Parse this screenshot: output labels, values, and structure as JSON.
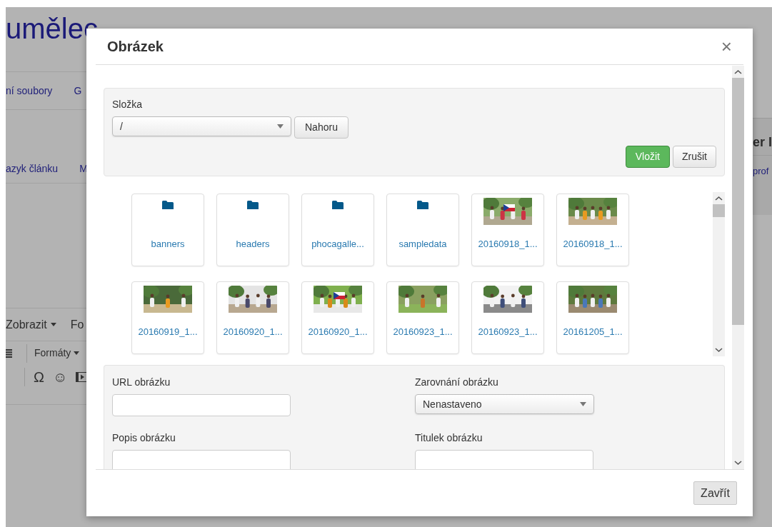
{
  "page": {
    "title": "umělec",
    "nav": [
      "ní soubory",
      "G"
    ],
    "subnav": [
      "azyk článku",
      "M"
    ],
    "editor_menu": [
      {
        "label": "Zobrazit",
        "caret": true
      },
      {
        "label": "Fo",
        "caret": false
      }
    ],
    "formats": "Formáty",
    "symbols": [
      "Ω",
      "☺"
    ],
    "side_heading": "er I",
    "side_link": "prof"
  },
  "dialog": {
    "title": "Obrázek",
    "close": "×",
    "folder_label": "Složka",
    "folder_value": "/",
    "up_button": "Nahoru",
    "insert_button": "Vložit",
    "cancel_button": "Zrušit",
    "items": [
      {
        "kind": "folder",
        "name": "banners"
      },
      {
        "kind": "folder",
        "name": "headers"
      },
      {
        "kind": "folder",
        "name": "phocagalle..."
      },
      {
        "kind": "folder",
        "name": "sampledata"
      },
      {
        "kind": "picture",
        "name": "20160918_1..."
      },
      {
        "kind": "picture",
        "name": "20160918_1..."
      },
      {
        "kind": "picture",
        "name": "20160919_1..."
      },
      {
        "kind": "picture",
        "name": "20160920_1..."
      },
      {
        "kind": "picture",
        "name": "20160920_1..."
      },
      {
        "kind": "picture",
        "name": "20160923_1..."
      },
      {
        "kind": "picture",
        "name": "20160923_1..."
      },
      {
        "kind": "picture",
        "name": "20161205_1..."
      }
    ],
    "fields": [
      {
        "kind": "text",
        "label": "URL obrázku"
      },
      {
        "kind": "select",
        "label": "Zarovnání obrázku",
        "value": "Nenastaveno"
      },
      {
        "kind": "text",
        "label": "Popis obrázku"
      },
      {
        "kind": "text",
        "label": "Titulek obrázku"
      }
    ],
    "footer_button": "Zavřít"
  }
}
